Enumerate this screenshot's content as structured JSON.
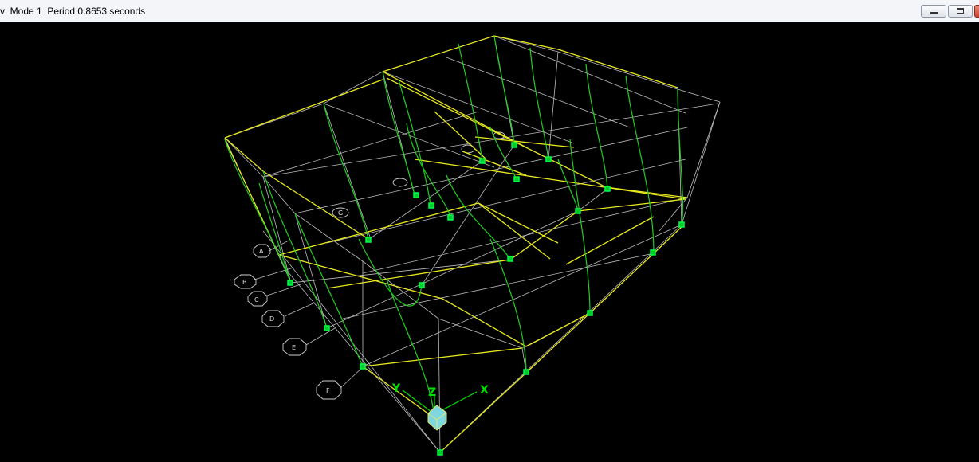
{
  "window": {
    "title": "v  Mode 1  Period 0.8653 seconds",
    "buttons": {
      "minimize": "minimize",
      "maximize": "maximize",
      "close": "close"
    }
  },
  "viewport": {
    "axes": {
      "x": "X",
      "y": "Y",
      "z": "Z"
    },
    "grid_bubbles": [
      "A",
      "B",
      "C",
      "D",
      "E",
      "F",
      "G"
    ],
    "colors": {
      "background": "#000000",
      "beam": "#e6e600",
      "deformed_column": "#20d020",
      "undeformed": "#c8c8c8",
      "support": "#00ff40"
    }
  }
}
